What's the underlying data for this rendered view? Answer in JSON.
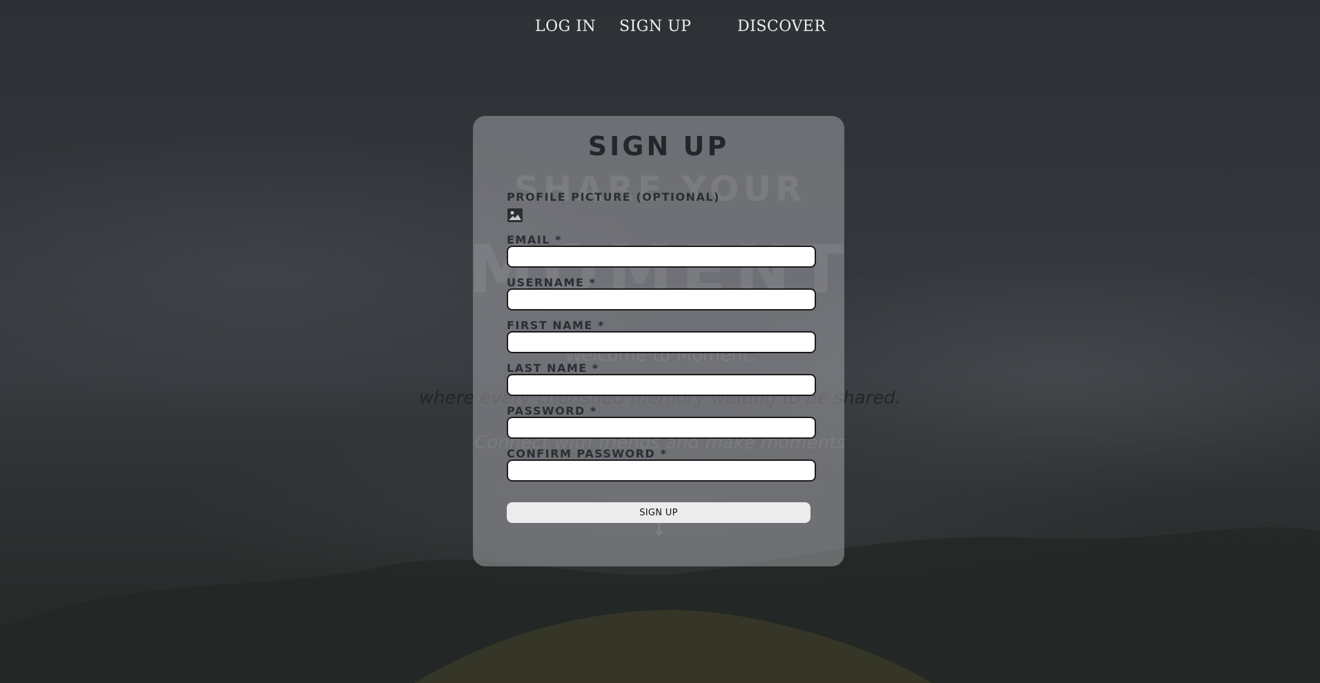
{
  "nav": {
    "login": "LOG IN",
    "signup": "SIGN UP",
    "discover": "DISCOVER"
  },
  "hero": {
    "line1": "SHARE YOUR",
    "line2": "MOMENT",
    "welcome": "Welcome to Moment.",
    "tagline": "where every cherished memory waiting to be shared.",
    "connect": "Connect with friends and make moments"
  },
  "form": {
    "title": "SIGN UP",
    "profile_picture_label": "PROFILE PICTURE (OPTIONAL)",
    "email_label": "EMAIL *",
    "username_label": "USERNAME *",
    "first_name_label": "FIRST NAME *",
    "last_name_label": "LAST NAME *",
    "password_label": "PASSWORD *",
    "confirm_password_label": "CONFIRM PASSWORD *",
    "email_value": "",
    "username_value": "",
    "first_name_value": "",
    "last_name_value": "",
    "password_value": "",
    "confirm_password_value": "",
    "submit_label": "SIGN UP",
    "image_icon": "image-icon"
  }
}
